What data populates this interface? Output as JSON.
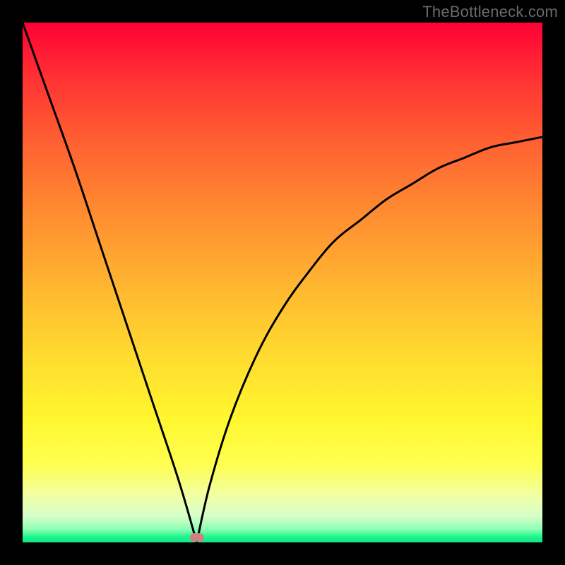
{
  "watermark": "TheBottleneck.com",
  "colors": {
    "page_bg": "#000000",
    "gradient_top": "#ff0034",
    "gradient_mid": "#ffe22f",
    "gradient_bottom": "#17e586",
    "curve": "#000000",
    "marker": "#d08080",
    "watermark_text": "#6a6a6a"
  },
  "chart_data": {
    "type": "line",
    "title": "",
    "xlabel": "",
    "ylabel": "",
    "xlim": [
      0,
      100
    ],
    "ylim": [
      0,
      100
    ],
    "grid": false,
    "legend": false,
    "annotations": [
      {
        "text": "TheBottleneck.com",
        "position": "top-right"
      }
    ],
    "marker": {
      "x": 33.5,
      "y": 1,
      "shape": "rounded-rect",
      "color": "#d08080"
    },
    "series": [
      {
        "name": "left-branch",
        "x": [
          0,
          5,
          10,
          15,
          20,
          25,
          30,
          33.5
        ],
        "y": [
          100,
          86,
          72,
          57,
          42,
          27,
          12,
          0
        ]
      },
      {
        "name": "right-branch",
        "x": [
          33.5,
          36,
          40,
          45,
          50,
          55,
          60,
          65,
          70,
          75,
          80,
          85,
          90,
          95,
          100
        ],
        "y": [
          0,
          11,
          24,
          36,
          45,
          52,
          58,
          62,
          66,
          69,
          72,
          74,
          76,
          77,
          78
        ]
      }
    ],
    "background_gradient": {
      "direction": "top-to-bottom",
      "stops": [
        {
          "pos": 0.0,
          "color": "#ff0034"
        },
        {
          "pos": 0.1,
          "color": "#ff2f33"
        },
        {
          "pos": 0.22,
          "color": "#ff5d32"
        },
        {
          "pos": 0.34,
          "color": "#ff8431"
        },
        {
          "pos": 0.46,
          "color": "#ffa831"
        },
        {
          "pos": 0.57,
          "color": "#ffc830"
        },
        {
          "pos": 0.67,
          "color": "#ffe22f"
        },
        {
          "pos": 0.76,
          "color": "#fff62e"
        },
        {
          "pos": 0.85,
          "color": "#feff4f"
        },
        {
          "pos": 0.91,
          "color": "#f2ffa3"
        },
        {
          "pos": 0.95,
          "color": "#d5ffcb"
        },
        {
          "pos": 0.975,
          "color": "#8cffb2"
        },
        {
          "pos": 0.99,
          "color": "#18f58d"
        },
        {
          "pos": 1.0,
          "color": "#17e586"
        }
      ]
    }
  }
}
